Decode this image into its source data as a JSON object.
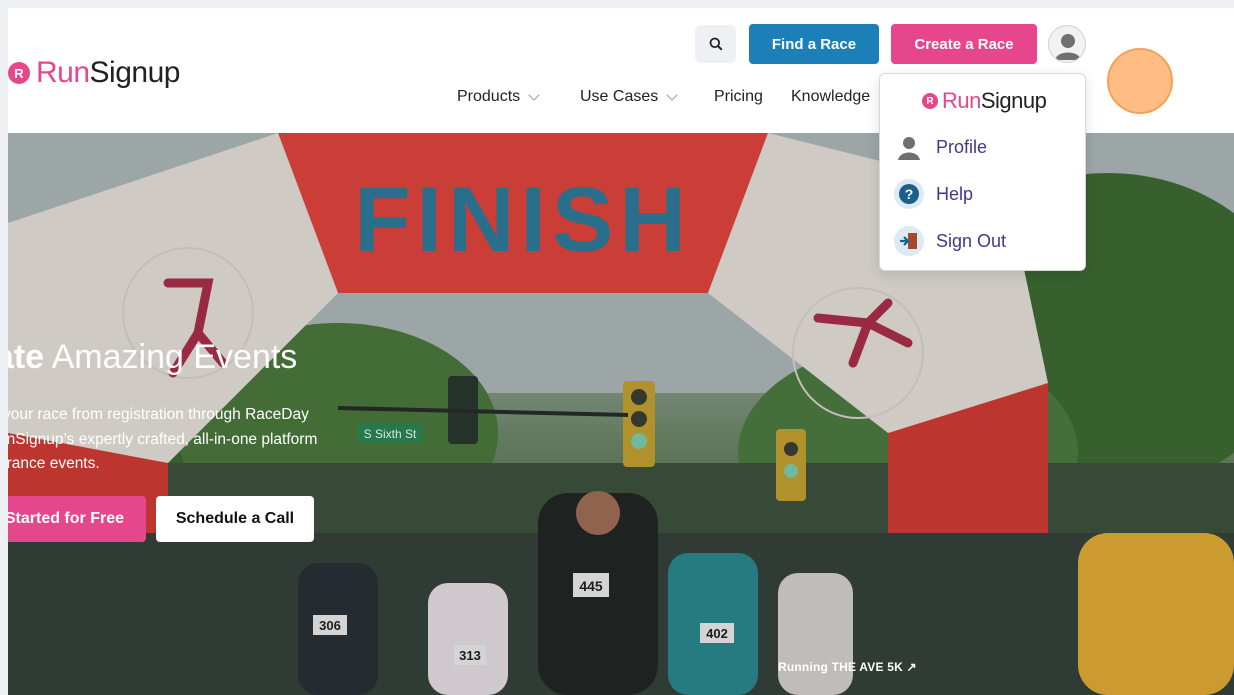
{
  "brand": {
    "badge": "R",
    "run": "Run",
    "signup": "Signup"
  },
  "header": {
    "find_race": "Find a Race",
    "create_race": "Create a Race"
  },
  "nav": [
    {
      "label": "Products",
      "dropdown": true
    },
    {
      "label": "Use Cases",
      "dropdown": true
    },
    {
      "label": "Pricing",
      "dropdown": false
    },
    {
      "label": "Knowledge",
      "dropdown": false
    }
  ],
  "hero": {
    "title_bold": "eate",
    "title_rest": " Amazing Events",
    "desc_line1": "your race from registration through RaceDay",
    "desc_line2": "unSignup’s expertly crafted, all-in-one platform",
    "desc_line3": "urance events.",
    "cta_primary": "Started for Free",
    "cta_secondary": "Schedule a Call",
    "caption": "Running THE AVE 5K ↗",
    "arch_text": "FINISH",
    "street_sign": "S Sixth St",
    "bibs": [
      "445",
      "306",
      "402",
      "313"
    ]
  },
  "account_menu": {
    "items": [
      {
        "label": "Profile",
        "icon": "person-icon"
      },
      {
        "label": "Help",
        "icon": "help-icon"
      },
      {
        "label": "Sign Out",
        "icon": "sign-out-icon"
      }
    ]
  },
  "colors": {
    "pink": "#e6468c",
    "blue": "#1d7fb8",
    "menu_text": "#3b3a8c"
  }
}
